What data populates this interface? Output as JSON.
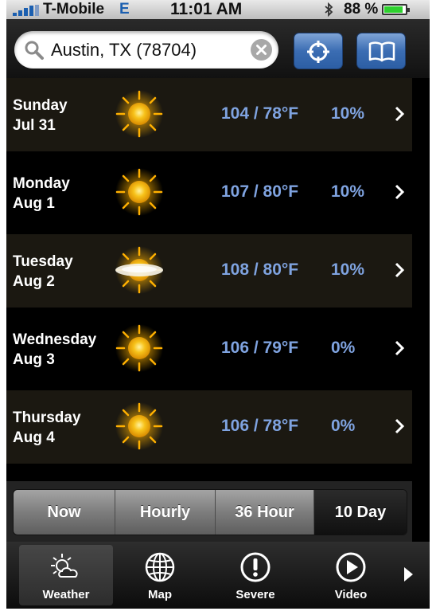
{
  "status_bar": {
    "carrier": "T-Mobile",
    "network": "E",
    "time": "11:01 AM",
    "battery": "88 %",
    "battery_level": 0.88,
    "icons": [
      "signal-icon",
      "bluetooth-icon",
      "battery-icon"
    ]
  },
  "search": {
    "value": "Austin, TX (78704)",
    "icons": [
      "search-icon",
      "clear-icon"
    ]
  },
  "header_buttons": [
    "locate-crosshair-icon",
    "book-icon"
  ],
  "forecast": [
    {
      "day": "Sunday",
      "date": "Jul 31",
      "icon": "sun-icon",
      "temps": "104 / 78°F",
      "precip": "10%"
    },
    {
      "day": "Monday",
      "date": "Aug 1",
      "icon": "sun-icon",
      "temps": "107 / 80°F",
      "precip": "10%"
    },
    {
      "day": "Tuesday",
      "date": "Aug 2",
      "icon": "hazy-sun-icon",
      "temps": "108 / 80°F",
      "precip": "10%"
    },
    {
      "day": "Wednesday",
      "date": "Aug 3",
      "icon": "sun-icon",
      "temps": "106 / 79°F",
      "precip": "0%"
    },
    {
      "day": "Thursday",
      "date": "Aug 4",
      "icon": "sun-icon",
      "temps": "106 / 78°F",
      "precip": "0%"
    }
  ],
  "segments": [
    "Now",
    "Hourly",
    "36 Hour",
    "10 Day"
  ],
  "active_segment": "10 Day",
  "tabs": [
    {
      "label": "Weather",
      "icon": "weather-icon"
    },
    {
      "label": "Map",
      "icon": "globe-icon"
    },
    {
      "label": "Severe",
      "icon": "alert-icon"
    },
    {
      "label": "Video",
      "icon": "play-icon"
    }
  ],
  "active_tab": "Weather",
  "colors": {
    "accent_blue": "#7fa3e0",
    "button_blue": "#3b6db3",
    "row_dark": "#1b1811",
    "sun": "#f5b400"
  }
}
